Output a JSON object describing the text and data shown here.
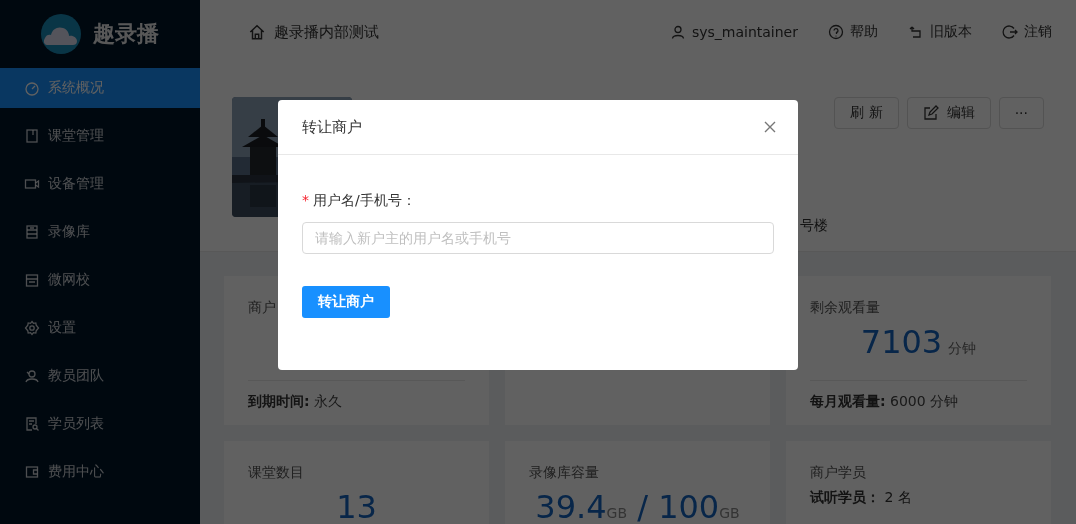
{
  "sidebar": {
    "logo": "趣录播",
    "items": [
      {
        "label": "系统概况",
        "selected": true
      },
      {
        "label": "课堂管理",
        "selected": false
      },
      {
        "label": "设备管理",
        "selected": false
      },
      {
        "label": "录像库",
        "selected": false
      },
      {
        "label": "微网校",
        "selected": false
      },
      {
        "label": "设置",
        "selected": false
      },
      {
        "label": "教员团队",
        "selected": false
      },
      {
        "label": "学员列表",
        "selected": false
      },
      {
        "label": "费用中心",
        "selected": false
      }
    ]
  },
  "header": {
    "title": "趣录播内部测试",
    "links": [
      {
        "label": "sys_maintainer"
      },
      {
        "label": "帮助"
      },
      {
        "label": "旧版本"
      },
      {
        "label": "注销"
      }
    ]
  },
  "profile": {
    "address": "号楼",
    "buttons": [
      {
        "label": "刷 新"
      },
      {
        "label": "编辑"
      },
      {
        "label": "···"
      }
    ]
  },
  "cards": [
    {
      "kind": "stat",
      "title": "商户",
      "footer": "**到期时间:** 永久"
    },
    {
      "kind": "blank"
    },
    {
      "kind": "stat",
      "title": "剩余观看量",
      "value": "7103",
      "unit": "分钟",
      "footer": "**每月观看量:** 6000 分钟"
    },
    {
      "kind": "stat",
      "title": "课堂数目",
      "value": "13"
    },
    {
      "kind": "capacity",
      "title": "录像库容量",
      "used": "39.4",
      "used_unit": "GB",
      "separator": "/",
      "total": "100",
      "total_unit": "GB"
    },
    {
      "kind": "lines",
      "title": "商户学员",
      "lines": [
        "**试听学员：** 2 名"
      ]
    }
  ],
  "modal": {
    "title": "转让商户",
    "field": {
      "label": "用户名/手机号：",
      "required_mark": "*",
      "placeholder": "请输入新户主的用户名或手机号"
    },
    "submit": "转让商户"
  }
}
